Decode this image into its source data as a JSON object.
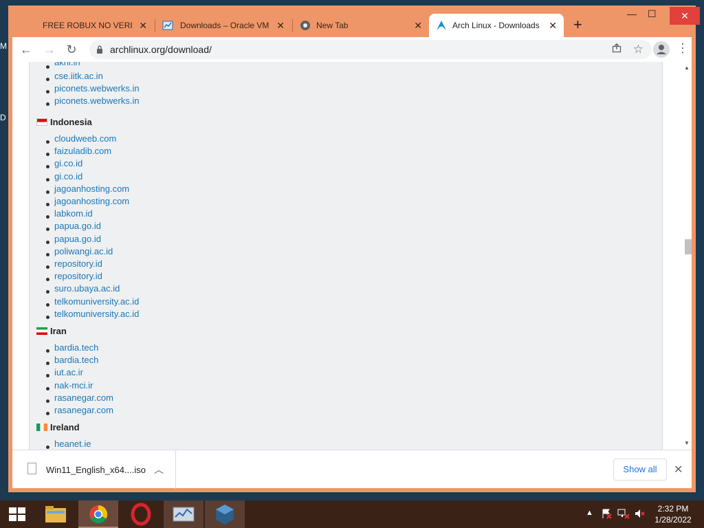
{
  "desktop": {
    "letters": [
      "M",
      "D"
    ]
  },
  "tabs": [
    {
      "title": "FREE ROBUX NO VERIFIC",
      "icon": "none",
      "close": "✕"
    },
    {
      "title": "Downloads – Oracle VM",
      "icon": "virtualbox-icon",
      "close": "✕"
    },
    {
      "title": "New Tab",
      "icon": "chrome-icon",
      "close": "✕"
    },
    {
      "title": "Arch Linux - Downloads",
      "icon": "arch-icon",
      "close": "✕",
      "active": true
    }
  ],
  "window_controls": {
    "minimize": "—",
    "maximize": "☐",
    "close": "✕"
  },
  "new_tab": "+",
  "toolbar": {
    "back": "←",
    "forward": "→",
    "reload": "↻",
    "url": "archlinux.org/download/"
  },
  "mirrors": {
    "india_tail": [
      "aknl.in",
      "cse.iitk.ac.in",
      "piconets.webwerks.in",
      "piconets.webwerks.in"
    ],
    "sections": [
      {
        "country": "Indonesia",
        "mirrors": [
          "cloudweeb.com",
          "faizuladib.com",
          "gi.co.id",
          "gi.co.id",
          "jagoanhosting.com",
          "jagoanhosting.com",
          "labkom.id",
          "papua.go.id",
          "papua.go.id",
          "poliwangi.ac.id",
          "repository.id",
          "repository.id",
          "suro.ubaya.ac.id",
          "telkomuniversity.ac.id",
          "telkomuniversity.ac.id"
        ]
      },
      {
        "country": "Iran",
        "mirrors": [
          "bardia.tech",
          "bardia.tech",
          "iut.ac.ir",
          "nak-mci.ir",
          "rasanegar.com",
          "rasanegar.com"
        ]
      },
      {
        "country": "Ireland",
        "mirrors": [
          "heanet.ie"
        ]
      }
    ]
  },
  "downloads": {
    "file_name": "Win11_English_x64....iso",
    "show_all": "Show all"
  },
  "clock": {
    "time": "2:32 PM",
    "date": "1/28/2022"
  }
}
